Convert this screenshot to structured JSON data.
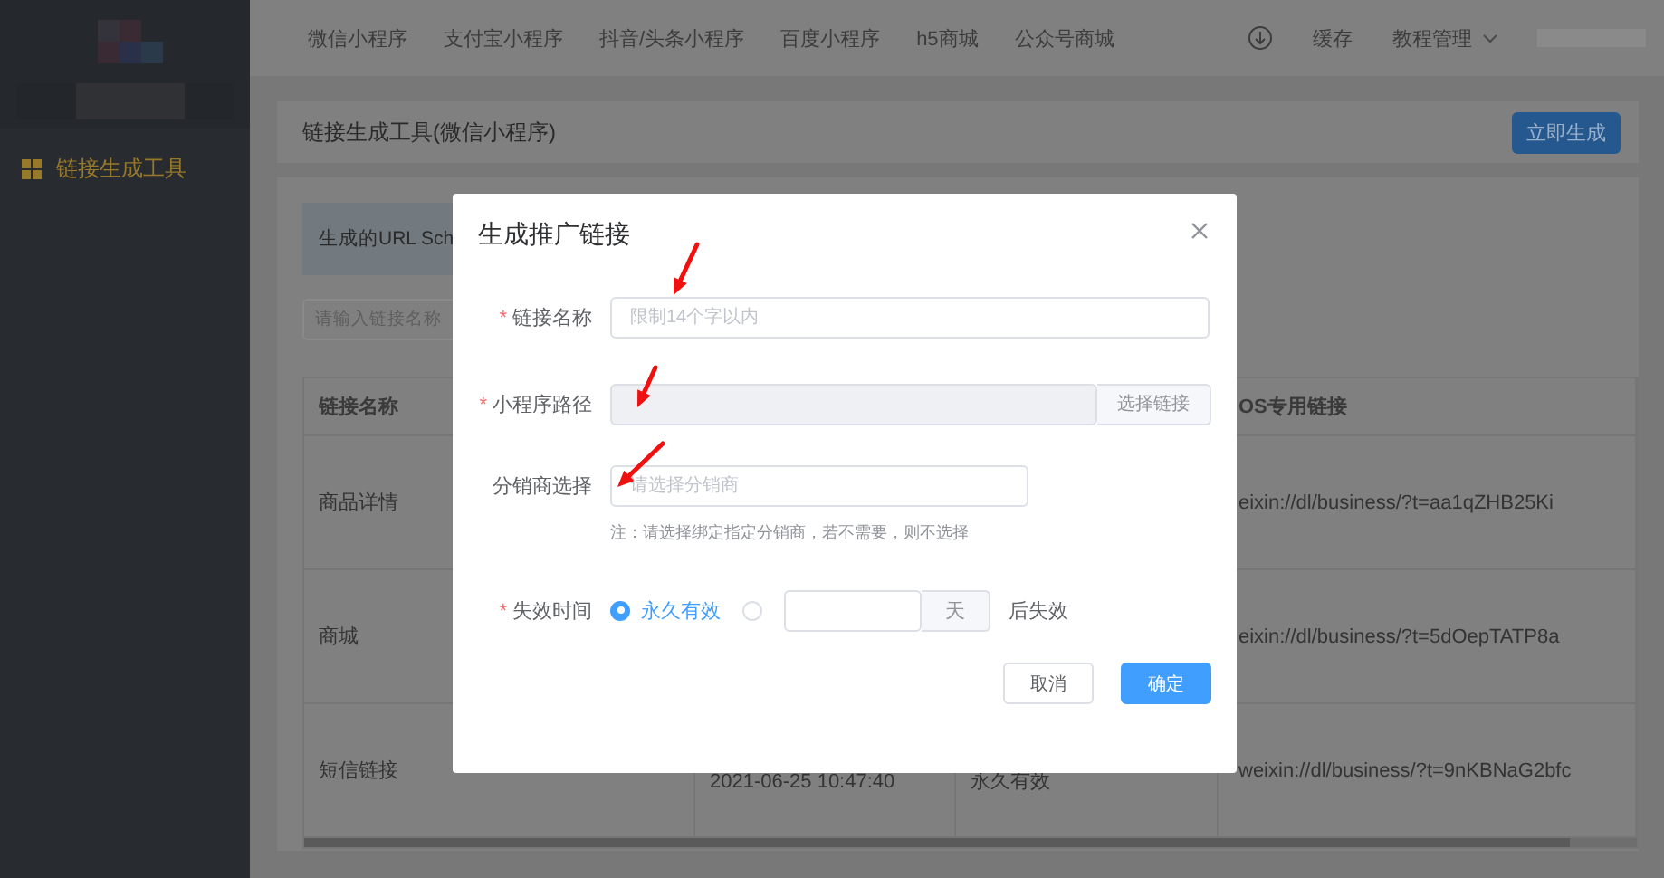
{
  "sidebar": {
    "items": [
      {
        "label": "链接生成工具",
        "selected": true
      }
    ]
  },
  "top_nav": {
    "items": [
      {
        "label": "微信小程序",
        "selected": false
      },
      {
        "label": "支付宝小程序",
        "selected": false
      },
      {
        "label": "抖音/头条小程序",
        "selected": false
      },
      {
        "label": "百度小程序",
        "selected": false
      },
      {
        "label": "h5商城",
        "selected": false
      },
      {
        "label": "公众号商城",
        "selected": false
      }
    ],
    "cache": "缓存",
    "tutorial": "教程管理"
  },
  "page": {
    "title": "链接生成工具(微信小程序)",
    "generate_button": "立即生成",
    "notice": "生成的URL Sch",
    "search": {
      "placeholder": "请输入链接名称"
    },
    "table": {
      "columns": [
        {
          "label": "链接名称"
        },
        {
          "label": "OS专用链接"
        }
      ],
      "rows": [
        {
          "name": "商品详情",
          "link": "eixin://dl/business/?t=aa1qZHB25Ki"
        },
        {
          "name": "商城",
          "link": "eixin://dl/business/?t=5dOepTATP8a"
        },
        {
          "name": "短信链接",
          "column_2": "2021-06-25 10:47:40",
          "column_3": "永久有效",
          "link": "weixin://dl/business/?t=9nKBNaG2bfc"
        }
      ]
    }
  },
  "dialog": {
    "title": "生成推广链接",
    "fields": [
      {
        "kind": "input",
        "label": "链接名称",
        "required_mark": "*",
        "placeholder": "限制14个字以内"
      },
      {
        "kind": "picker",
        "label": "小程序路径",
        "required_mark": "*",
        "disabled": true,
        "button": "选择链接"
      },
      {
        "kind": "select",
        "label": "分销商选择",
        "placeholder": "请选择分销商",
        "hint": "注：请选择绑定指定分销商，若不需要，则不选择"
      },
      {
        "kind": "expiry",
        "label": "失效时间",
        "required_mark": "*",
        "options": [
          {
            "label": "永久有效",
            "selected": true
          },
          {
            "selected": false,
            "unit": "天",
            "suffix": "后失效"
          }
        ]
      }
    ],
    "buttons": [
      {
        "label": "取消",
        "primary": false
      },
      {
        "label": "确定",
        "primary": true
      }
    ]
  }
}
